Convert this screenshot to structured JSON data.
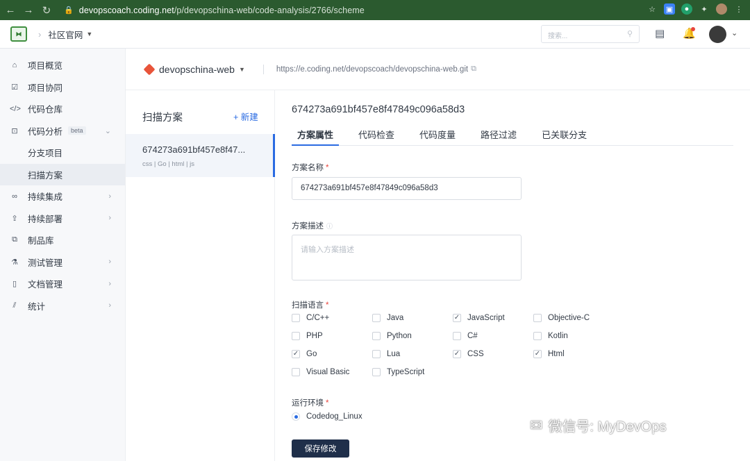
{
  "browser": {
    "url_host": "devopscoach.coding.net",
    "url_path": "/p/devopschina-web/code-analysis/2766/scheme"
  },
  "topbar": {
    "org": "社区官网",
    "search_placeholder": "搜索..."
  },
  "sidebar": {
    "items": [
      {
        "label": "项目概览",
        "icon": "home-icon"
      },
      {
        "label": "项目协同",
        "icon": "checkbox-icon"
      },
      {
        "label": "代码仓库",
        "icon": "code-icon"
      },
      {
        "label": "代码分析",
        "icon": "terminal-icon",
        "badge": "beta"
      },
      {
        "label": "分支项目"
      },
      {
        "label": "扫描方案"
      },
      {
        "label": "持续集成",
        "icon": "infinity-icon"
      },
      {
        "label": "持续部署",
        "icon": "rocket-icon"
      },
      {
        "label": "制品库",
        "icon": "package-icon"
      },
      {
        "label": "测试管理",
        "icon": "flask-icon"
      },
      {
        "label": "文档管理",
        "icon": "document-icon"
      },
      {
        "label": "统计",
        "icon": "chart-icon"
      }
    ]
  },
  "repo": {
    "name": "devopschina-web",
    "url": "https://e.coding.net/devopscoach/devopschina-web.git"
  },
  "scheme_list": {
    "title": "扫描方案",
    "new_label": "+ 新建",
    "items": [
      {
        "title": "674273a691bf457e8f47...",
        "langs": "css | Go | html | js"
      }
    ]
  },
  "main": {
    "title": "674273a691bf457e8f47849c096a58d3",
    "tabs": [
      "方案属性",
      "代码检查",
      "代码度量",
      "路径过滤",
      "已关联分支"
    ],
    "name_label": "方案名称",
    "name_value": "674273a691bf457e8f47849c096a58d3",
    "desc_label": "方案描述",
    "desc_placeholder": "请输入方案描述",
    "lang_label": "扫描语言",
    "languages": [
      {
        "name": "C/C++",
        "checked": false
      },
      {
        "name": "Java",
        "checked": false
      },
      {
        "name": "JavaScript",
        "checked": true
      },
      {
        "name": "Objective-C",
        "checked": false
      },
      {
        "name": "PHP",
        "checked": false
      },
      {
        "name": "Python",
        "checked": false
      },
      {
        "name": "C#",
        "checked": false
      },
      {
        "name": "Kotlin",
        "checked": false
      },
      {
        "name": "Go",
        "checked": true
      },
      {
        "name": "Lua",
        "checked": false
      },
      {
        "name": "CSS",
        "checked": true
      },
      {
        "name": "Html",
        "checked": true
      },
      {
        "name": "Visual Basic",
        "checked": false
      },
      {
        "name": "TypeScript",
        "checked": false
      }
    ],
    "env_label": "运行环境",
    "env_value": "Codedog_Linux",
    "save_label": "保存修改"
  },
  "watermark": "微信号: MyDevOps",
  "colors": {
    "accent": "#2a6be2",
    "browser_bar": "#2b5a2f",
    "save_button": "#1f2f4a"
  }
}
